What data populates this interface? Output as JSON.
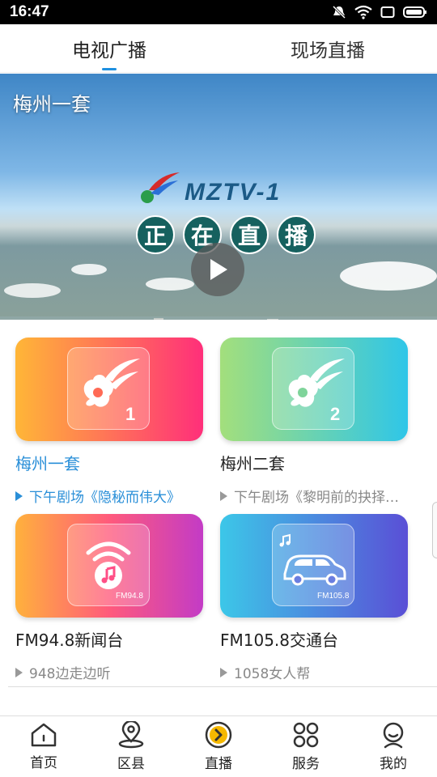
{
  "status_bar": {
    "time": "16:47"
  },
  "tabs": [
    {
      "label": "电视广播",
      "active": true
    },
    {
      "label": "现场直播",
      "active": false
    }
  ],
  "hero": {
    "channel_title": "梅州一套",
    "logo_text": "MZTV-1",
    "live_text": [
      "正",
      "在",
      "直",
      "播"
    ]
  },
  "channels": [
    {
      "name": "梅州一套",
      "program": "下午剧场《隐秘而伟大》",
      "badge": "1",
      "icon": "mztv-logo-icon",
      "active": true,
      "gradient": [
        "#ffb637",
        "#ff2f7a"
      ]
    },
    {
      "name": "梅州二套",
      "program": "下午剧场《黎明前的抉择…",
      "badge": "2",
      "icon": "mztv-logo-icon",
      "active": false,
      "gradient": [
        "#a3df7c",
        "#2fc6e8"
      ]
    },
    {
      "name": "FM94.8新闻台",
      "program": "948边走边听",
      "badge": "FM94.8",
      "icon": "radio-music-icon",
      "active": false,
      "gradient": [
        "#ffb13c",
        "#c33bc6"
      ]
    },
    {
      "name": "FM105.8交通台",
      "program": "1058女人帮",
      "badge": "FM105.8",
      "icon": "car-icon",
      "active": false,
      "gradient": [
        "#3cc7e8",
        "#5a4fd6"
      ]
    }
  ],
  "bottom_nav": [
    {
      "label": "首页",
      "icon": "home-icon"
    },
    {
      "label": "区县",
      "icon": "location-pin-icon"
    },
    {
      "label": "直播",
      "icon": "live-play-icon"
    },
    {
      "label": "服务",
      "icon": "grid-circles-icon"
    },
    {
      "label": "我的",
      "icon": "user-icon"
    }
  ],
  "colors": {
    "accent": "#2a8fd8",
    "live_icon": "#f5b800"
  }
}
